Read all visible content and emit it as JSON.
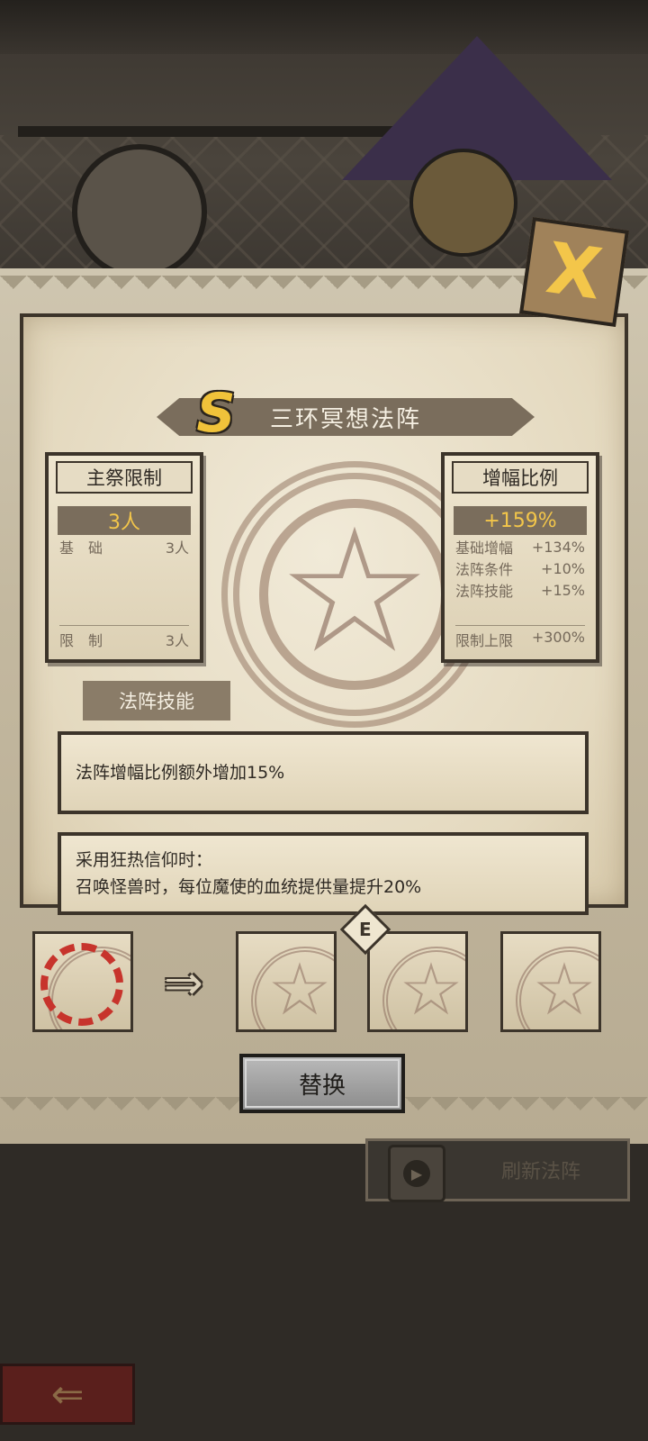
{
  "title": "三环冥想法阵",
  "rank_badge": "S",
  "close_icon": "X",
  "host_limit": {
    "header": "主祭限制",
    "value": "3人",
    "rows": [
      {
        "label": "基　础",
        "value": "3人"
      }
    ],
    "footer_label": "限　制",
    "footer_value": "3人"
  },
  "amplify": {
    "header": "增幅比例",
    "value": "+159%",
    "rows": [
      {
        "label": "基础增幅",
        "value": "+134%"
      },
      {
        "label": "法阵条件",
        "value": "+10%"
      },
      {
        "label": "法阵技能",
        "value": "+15%"
      }
    ],
    "footer_label": "限制上限",
    "footer_value": "+300%"
  },
  "skill": {
    "tab_label": "法阵技能",
    "description_1": "法阵增幅比例额外增加15%",
    "description_2_line_1": "采用狂热信仰时：",
    "description_2_line_2": "召唤怪兽时，每位魔使的血统提供量提升20%"
  },
  "slots": {
    "lock_badge": "E"
  },
  "buttons": {
    "replace": "替换",
    "refresh": "刷新法阵"
  },
  "colors": {
    "accent_gold": "#f3c64a",
    "parchment": "#e4d9bf",
    "ink": "#3c342a",
    "selection_red": "#c7342c"
  }
}
